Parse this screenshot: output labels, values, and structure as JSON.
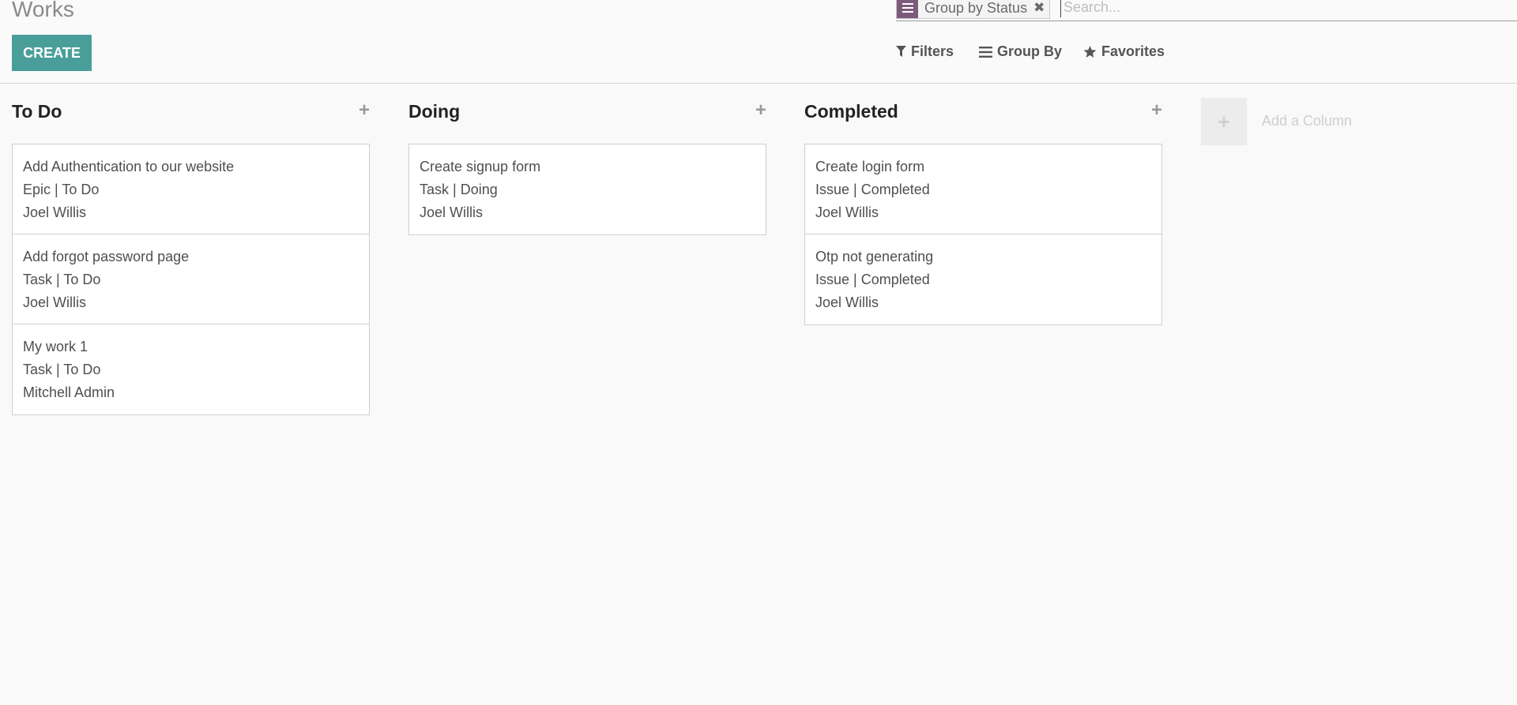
{
  "header": {
    "title": "Works",
    "create_label": "CREATE"
  },
  "search": {
    "facet_label": "Group by Status",
    "remove_symbol": "✖",
    "placeholder": "Search..."
  },
  "search_options": {
    "filters": "Filters",
    "group_by": "Group By",
    "favorites": "Favorites"
  },
  "columns": [
    {
      "title": "To Do",
      "add_symbol": "+",
      "cards": [
        {
          "name": "Add Authentication to our website",
          "meta": "Epic | To Do",
          "assignee": "Joel Willis"
        },
        {
          "name": "Add forgot password page",
          "meta": "Task | To Do",
          "assignee": "Joel Willis"
        },
        {
          "name": "My work 1",
          "meta": "Task | To Do",
          "assignee": "Mitchell Admin"
        }
      ]
    },
    {
      "title": "Doing",
      "add_symbol": "+",
      "cards": [
        {
          "name": "Create signup form",
          "meta": "Task | Doing",
          "assignee": "Joel Willis"
        }
      ]
    },
    {
      "title": "Completed",
      "add_symbol": "+",
      "cards": [
        {
          "name": "Create login form",
          "meta": "Issue | Completed",
          "assignee": "Joel Willis"
        },
        {
          "name": "Otp not generating",
          "meta": "Issue | Completed",
          "assignee": "Joel Willis"
        }
      ]
    }
  ],
  "add_column": {
    "symbol": "+",
    "label": "Add a Column"
  },
  "colors": {
    "accent": "#4a9e9a",
    "facet": "#7c5a7c"
  }
}
